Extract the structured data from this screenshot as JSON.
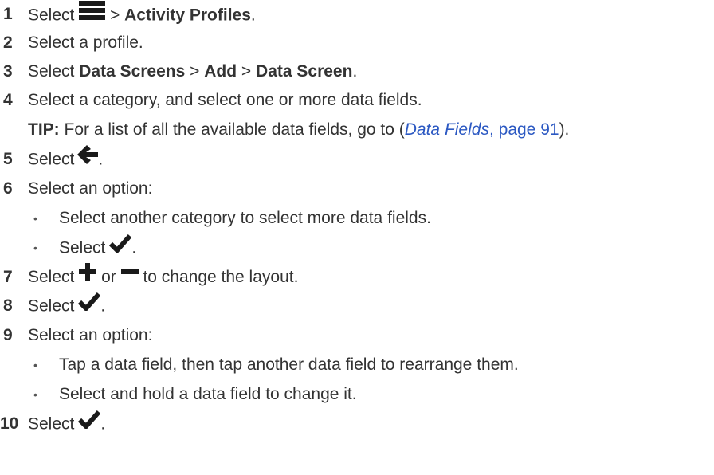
{
  "steps": [
    {
      "num": "1",
      "pre": "Select",
      "sep": ">",
      "bold": "Activity Profiles",
      "post": ".",
      "icon": "menu-icon"
    },
    {
      "num": "2",
      "text": "Select a profile."
    },
    {
      "num": "3",
      "pre": "Select",
      "b1": "Data Screens",
      "sep1": ">",
      "b2": "Add",
      "sep2": ">",
      "b3": "Data Screen",
      "post": "."
    },
    {
      "num": "4",
      "text": "Select a category, and select one or more data fields.",
      "tip_label": "TIP:",
      "tip_text": "For a list of all the available data fields, go to (",
      "tip_link_italic": "Data Fields",
      "tip_link_rest": ", page 91",
      "tip_end": ")."
    },
    {
      "num": "5",
      "pre": "Select",
      "post": ".",
      "icon": "back-arrow-icon"
    },
    {
      "num": "6",
      "text": "Select an option:",
      "bullets": [
        "Select another category to select more data fields.",
        "Select"
      ],
      "bullet_post": ".",
      "bullet_icon": "checkmark-icon"
    },
    {
      "num": "7",
      "pre": "Select",
      "mid": "or",
      "post": "to change the layout.",
      "icons": [
        "plus-icon",
        "minus-icon"
      ]
    },
    {
      "num": "8",
      "pre": "Select",
      "post": ".",
      "icon": "checkmark-icon"
    },
    {
      "num": "9",
      "text": "Select an option:",
      "bullets": [
        "Tap a data field, then tap another data field to rearrange them.",
        "Select and hold a data field to change it."
      ]
    },
    {
      "num": "10",
      "pre": "Select",
      "post": ".",
      "icon": "checkmark-icon"
    }
  ],
  "colors": {
    "text": "#333333",
    "link": "#2b58c2",
    "icon": "#1a1a1a"
  }
}
